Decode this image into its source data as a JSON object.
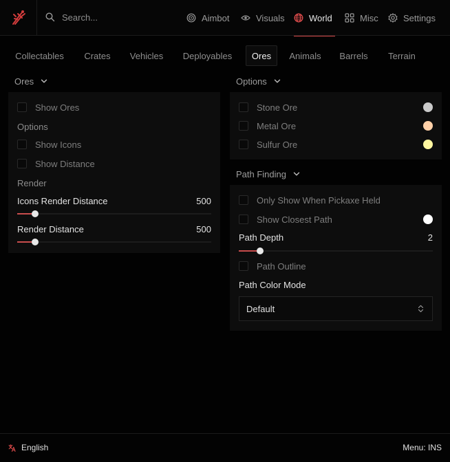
{
  "header": {
    "search_placeholder": "Search...",
    "nav": [
      {
        "label": "Aimbot",
        "icon": "target-icon"
      },
      {
        "label": "Visuals",
        "icon": "eye-icon"
      },
      {
        "label": "World",
        "icon": "globe-icon",
        "active": true
      },
      {
        "label": "Misc",
        "icon": "grid-icon"
      },
      {
        "label": "Settings",
        "icon": "gear-icon"
      }
    ]
  },
  "tabs": [
    "Collectables",
    "Crates",
    "Vehicles",
    "Deployables",
    "Ores",
    "Animals",
    "Barrels",
    "Terrain"
  ],
  "active_tab": "Ores",
  "left": {
    "header": "Ores",
    "show_ores": "Show Ores",
    "options_label": "Options",
    "show_icons": "Show Icons",
    "show_distance": "Show Distance",
    "render_label": "Render",
    "icons_render_distance": {
      "label": "Icons Render Distance",
      "value": "500",
      "fraction": 0.093
    },
    "render_distance": {
      "label": "Render Distance",
      "value": "500",
      "fraction": 0.093
    }
  },
  "right": {
    "options_header": "Options",
    "ores": [
      {
        "label": "Stone Ore",
        "color": "#c9c9c9"
      },
      {
        "label": "Metal Ore",
        "color": "#ffd0a8"
      },
      {
        "label": "Sulfur Ore",
        "color": "#fff7a0"
      }
    ],
    "path_header": "Path Finding",
    "only_show_pickaxe": "Only Show When Pickaxe Held",
    "show_closest_path": "Show Closest Path",
    "closest_path_color": "#ffffff",
    "path_depth": {
      "label": "Path Depth",
      "value": "2",
      "fraction": 0.11
    },
    "path_outline": "Path Outline",
    "path_color_mode": "Path Color Mode",
    "path_color_mode_value": "Default"
  },
  "footer": {
    "language": "English",
    "menu_key": "Menu: INS"
  },
  "colors": {
    "accent": "#d94a4a",
    "panel": "#0d0d0d",
    "background": "#020202"
  }
}
